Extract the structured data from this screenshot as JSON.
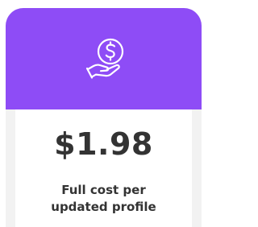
{
  "pricing_card": {
    "icon": "hand-holding-dollar-icon",
    "price": "$1.98",
    "caption_line1": "Full cost per",
    "caption_line2": "updated profile"
  },
  "colors": {
    "header": "#8e4cf6",
    "icon_stroke": "#ffffff",
    "text": "#333333",
    "card_border": "#f2f2f2",
    "card_body": "#ffffff"
  }
}
